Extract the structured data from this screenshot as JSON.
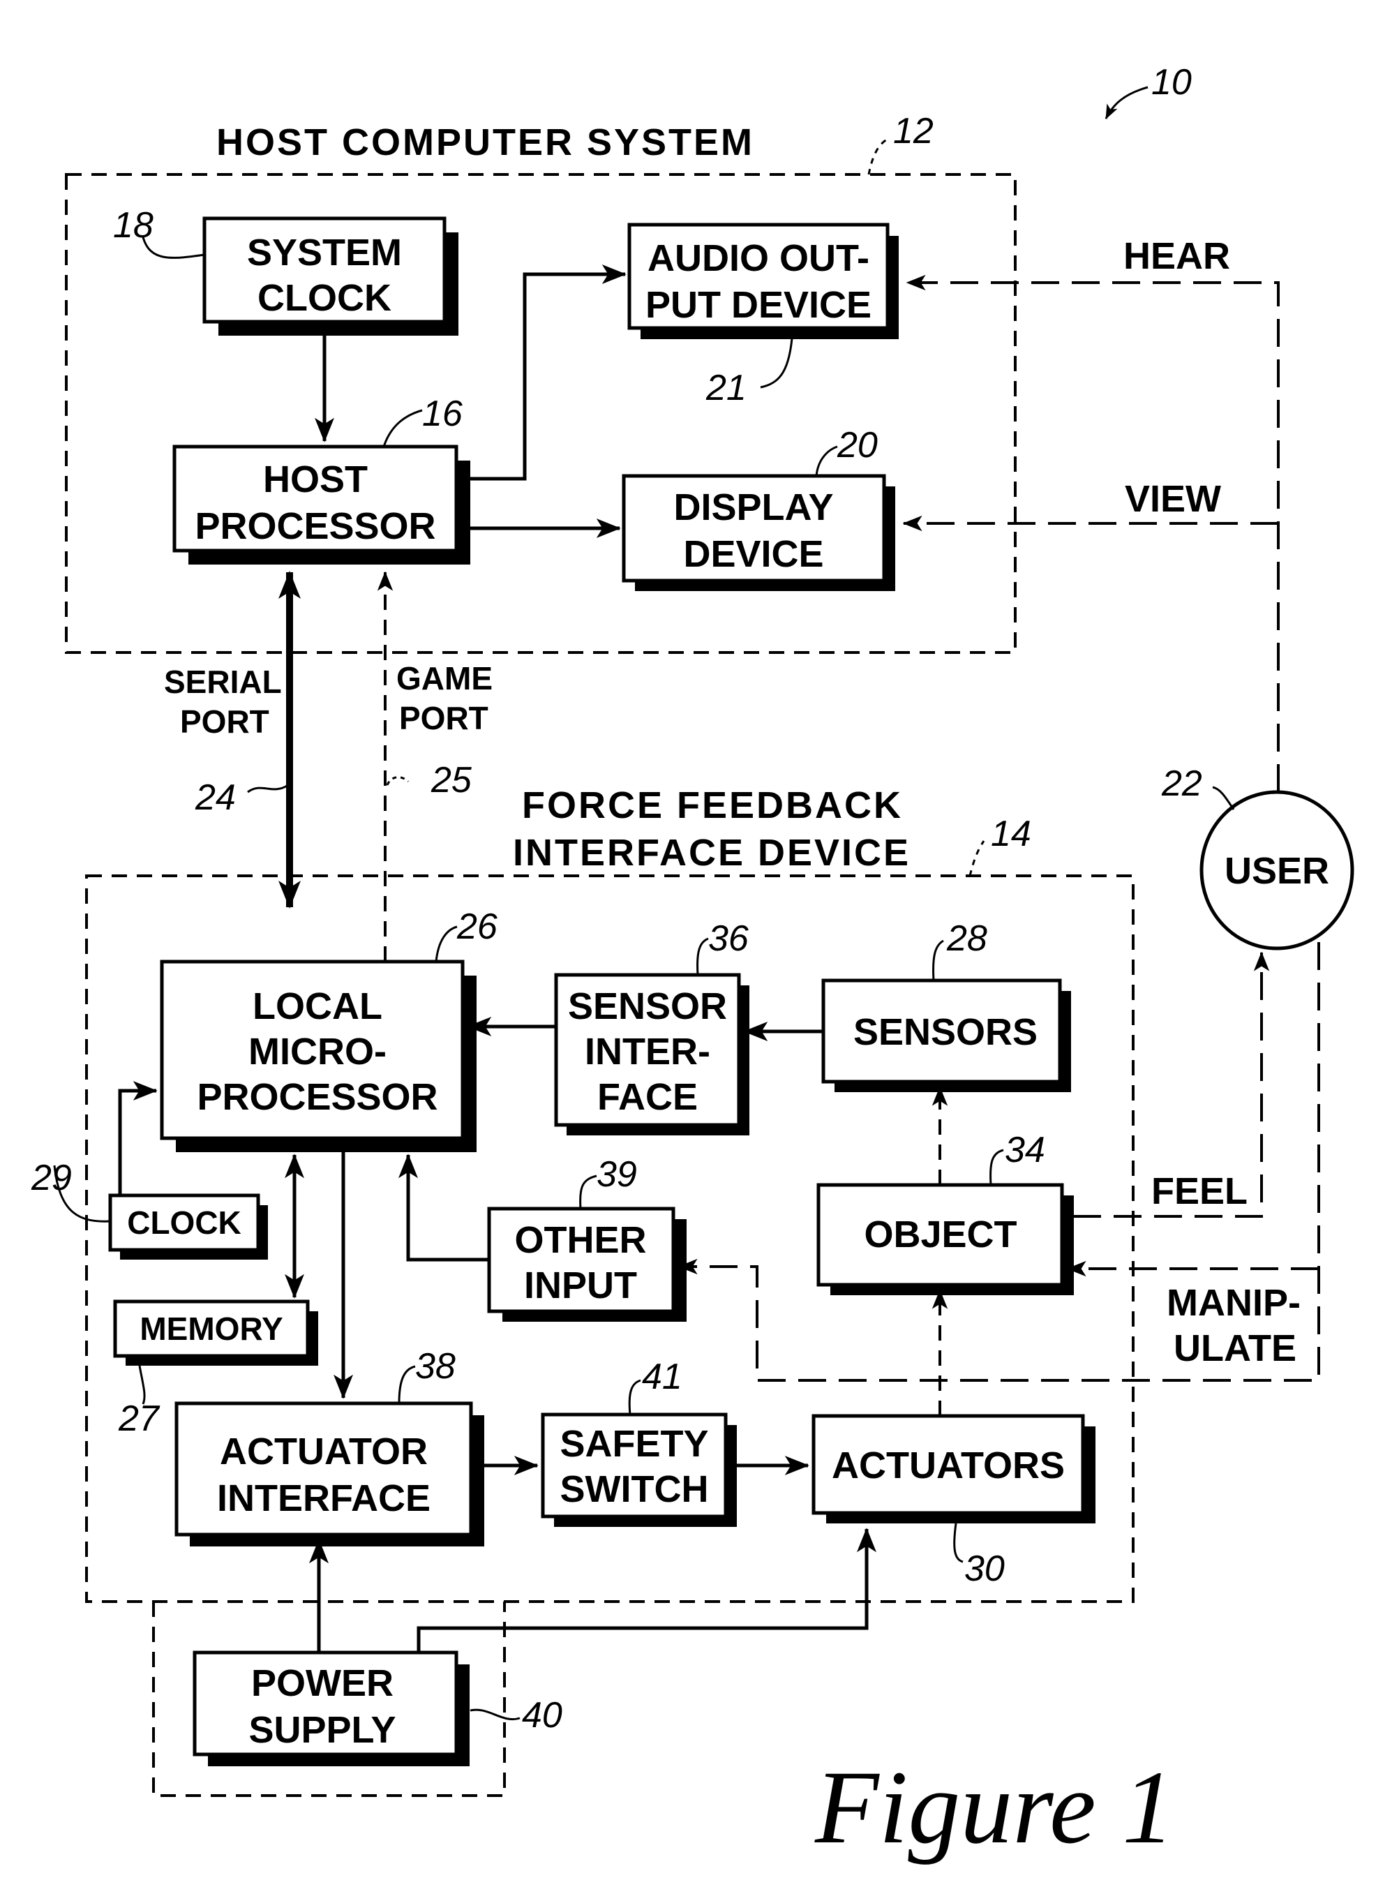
{
  "figure": {
    "caption": "Figure 1",
    "ref_number": "10"
  },
  "groups": {
    "host": {
      "title": "HOST COMPUTER SYSTEM",
      "ref": "12"
    },
    "force_feedback": {
      "title_line1": "FORCE FEEDBACK",
      "title_line2": "INTERFACE DEVICE",
      "ref": "14"
    }
  },
  "blocks": {
    "system_clock": {
      "lines": [
        "SYSTEM",
        "CLOCK"
      ],
      "ref": "18"
    },
    "audio_output": {
      "lines": [
        "AUDIO OUT-",
        "PUT DEVICE"
      ],
      "ref": "21"
    },
    "host_processor": {
      "lines": [
        "HOST",
        "PROCESSOR"
      ],
      "ref": "16"
    },
    "display_device": {
      "lines": [
        "DISPLAY",
        "DEVICE"
      ],
      "ref": "20"
    },
    "user": {
      "lines": [
        "USER"
      ],
      "ref": "22"
    },
    "local_microprocessor": {
      "lines": [
        "LOCAL",
        "MICRO-",
        "PROCESSOR"
      ],
      "ref": "26"
    },
    "sensor_interface": {
      "lines": [
        "SENSOR",
        "INTER-",
        "FACE"
      ],
      "ref": "36"
    },
    "sensors": {
      "lines": [
        "SENSORS"
      ],
      "ref": "28"
    },
    "clock": {
      "lines": [
        "CLOCK"
      ],
      "ref": "29"
    },
    "memory": {
      "lines": [
        "MEMORY"
      ],
      "ref": "27"
    },
    "other_input": {
      "lines": [
        "OTHER",
        "INPUT"
      ],
      "ref": "39"
    },
    "object": {
      "lines": [
        "OBJECT"
      ],
      "ref": "34"
    },
    "actuator_interface": {
      "lines": [
        "ACTUATOR",
        "INTERFACE"
      ],
      "ref": "38"
    },
    "safety_switch": {
      "lines": [
        "SAFETY",
        "SWITCH"
      ],
      "ref": "41"
    },
    "actuators": {
      "lines": [
        "ACTUATORS"
      ],
      "ref": "30"
    },
    "power_supply": {
      "lines": [
        "POWER",
        "SUPPLY"
      ],
      "ref": "40"
    }
  },
  "connections": {
    "serial_port": {
      "lines": [
        "SERIAL",
        "PORT"
      ],
      "ref": "24"
    },
    "game_port": {
      "lines": [
        "GAME",
        "PORT"
      ],
      "ref": "25"
    },
    "hear": {
      "label": "HEAR"
    },
    "view": {
      "label": "VIEW"
    },
    "feel": {
      "label": "FEEL"
    },
    "manipulate": {
      "lines": [
        "MANIP-",
        "ULATE"
      ]
    }
  }
}
